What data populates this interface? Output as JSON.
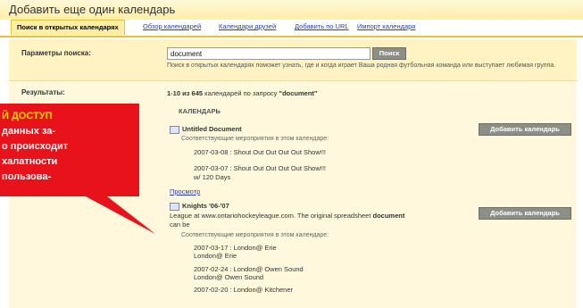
{
  "title": "Добавить еще один календарь",
  "tabs": [
    {
      "label": "Поиск в открытых календарях"
    },
    {
      "label": "Обзор календарей"
    },
    {
      "label": "Календари друзей"
    },
    {
      "label": "Добавить по URL"
    },
    {
      "label": "Импорт календаря"
    }
  ],
  "search": {
    "label": "Параметры поиска:",
    "value": "document",
    "button": "Поиск",
    "hint": "Поиск в открытых календарях поможет узнать, где и когда играет Ваша родная футбольная команда или выступает любимая группа."
  },
  "results": {
    "label": "Результаты:",
    "summary_prefix": "1-10 из 645",
    "summary_middle": "календарей по запросу",
    "query": "\"document\"",
    "section_heading": "КАЛЕНДАРЬ",
    "matching_label": "Соответствующие мероприятия в этом календаре:",
    "add_button": "Добавить календарь",
    "preview_link": "Просмотр",
    "items": [
      {
        "name": "Untitled Document",
        "events": [
          "2007-03-08 : Shout Out Out Out Out Show!!!",
          "2007-03-07 : Shout Out Out Out Out Show!!!",
          "w/ 120 Days"
        ]
      },
      {
        "name": "Knights '06-'07",
        "description_pre": "League at www.ontariohockeyleague.com. The original spreadsheet",
        "description_bold": "document",
        "description_post": "can be",
        "events": [
          "2007-03-17 : London@ Erie",
          "London@ Erie",
          "2007-02-24 : London@ Owen Sound",
          "London@ Owen Sound",
          "2007-02-20 : London@ Kitchener"
        ]
      }
    ]
  },
  "callout": {
    "line1": "Й ДОСТУП",
    "line2": "данных за-",
    "line3": "о происходит",
    "line4": "халатности",
    "line5": "пользова-"
  },
  "colors": {
    "callout_red": "#e8121b",
    "callout_yellow": "#ffd100",
    "accent_yellow": "#e3c23b"
  }
}
